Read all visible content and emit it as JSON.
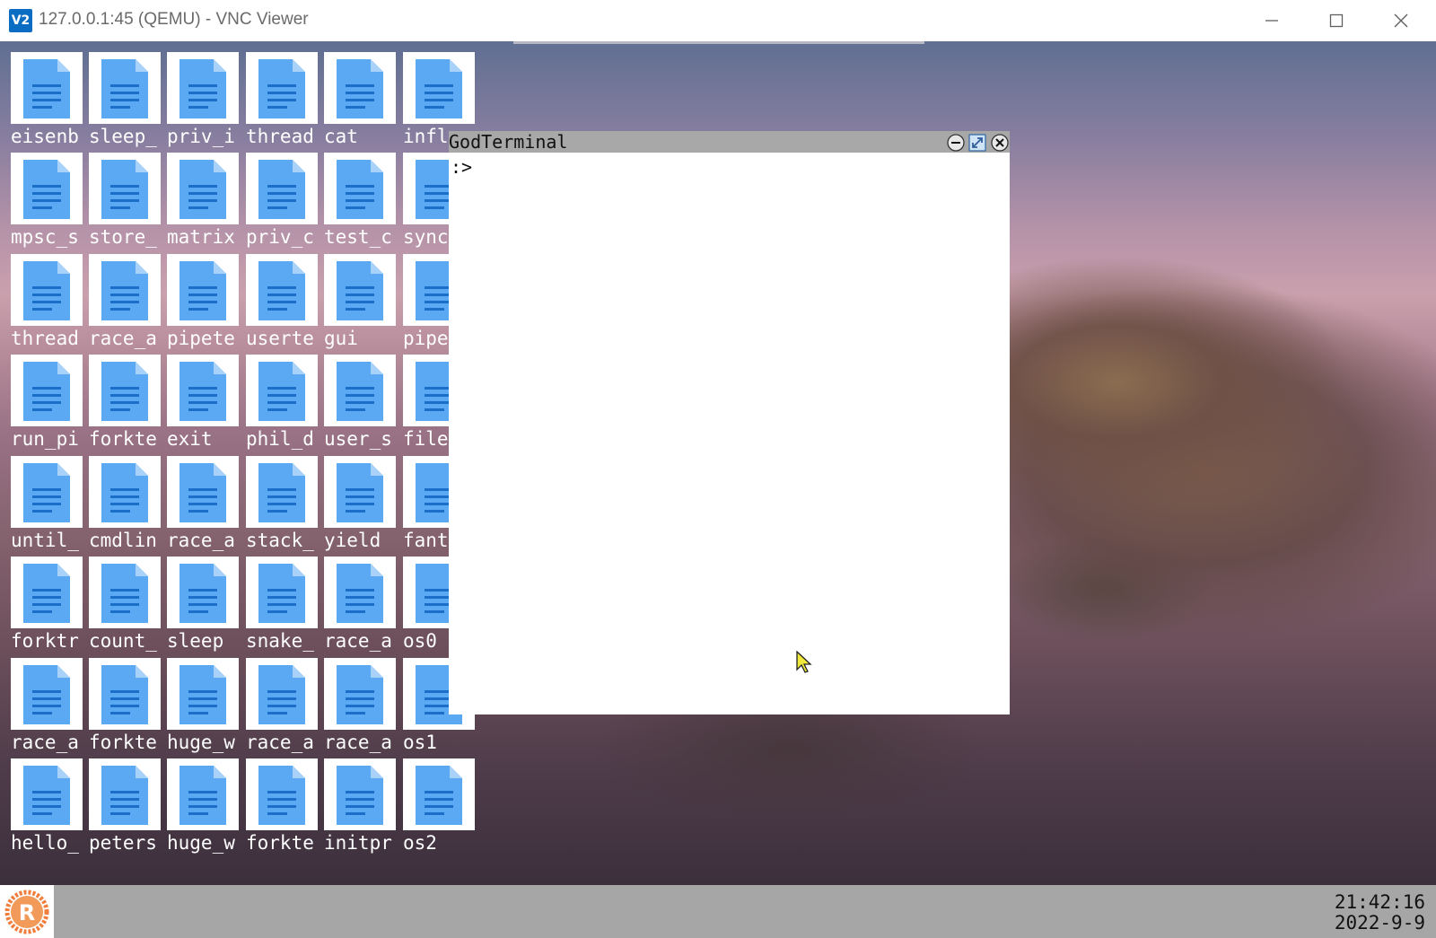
{
  "host_window": {
    "logo_text": "V2",
    "title": "127.0.0.1:45 (QEMU) - VNC Viewer",
    "buttons": [
      "minimize",
      "maximize",
      "close"
    ]
  },
  "desktop": {
    "icon_type": "document-icon",
    "icon_color": "#5aa9f2",
    "icons": [
      [
        "eisenb",
        "sleep_",
        "priv_i",
        "thread",
        "cat",
        "infl"
      ],
      [
        "mpsc_s",
        "store_",
        "matrix",
        "priv_c",
        "test_c",
        "sync"
      ],
      [
        "thread",
        "race_a",
        "pipete",
        "userte",
        "gui",
        "pipe"
      ],
      [
        "run_pi",
        "forkte",
        "exit",
        "phil_d",
        "user_s",
        "file"
      ],
      [
        "until_",
        "cmdlin",
        "race_a",
        "stack_",
        "yield",
        "fant"
      ],
      [
        "forktr",
        "count_",
        "sleep",
        "snake_",
        "race_a",
        "os0"
      ],
      [
        "race_a",
        "forkte",
        "huge_w",
        "race_a",
        "race_a",
        "os1"
      ],
      [
        "hello_",
        "peters",
        "huge_w",
        "forkte",
        "initpr",
        "os2"
      ]
    ]
  },
  "terminal": {
    "title": "GodTerminal",
    "prompt": ":>",
    "buttons": [
      "minimize",
      "maximize",
      "close"
    ]
  },
  "taskbar": {
    "start_icon": "rust-logo-icon",
    "time": "21:42:16",
    "date": "2022-9-9"
  }
}
